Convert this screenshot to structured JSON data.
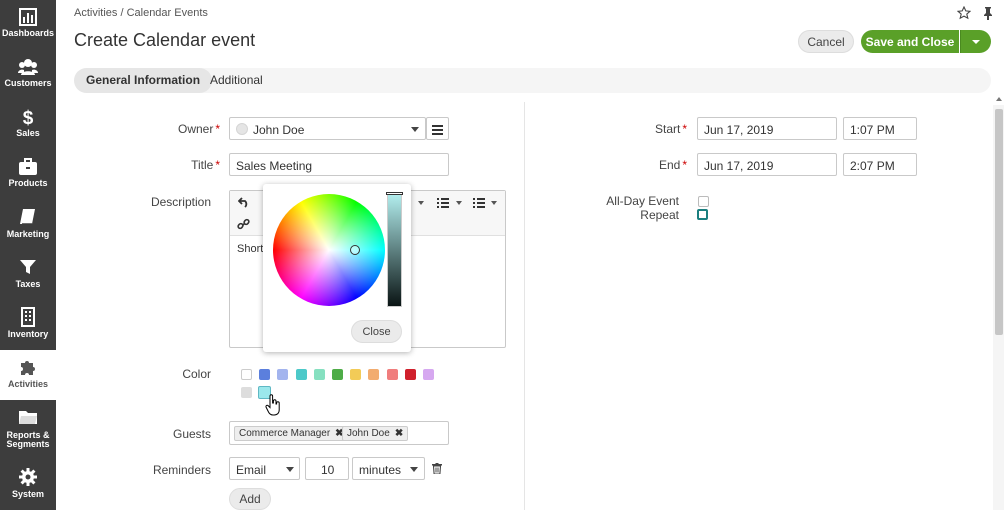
{
  "sidebar": {
    "items": [
      {
        "label": "Dashboards",
        "icon": "dashboard-icon"
      },
      {
        "label": "Customers",
        "icon": "users-icon"
      },
      {
        "label": "Sales",
        "icon": "dollar-icon"
      },
      {
        "label": "Products",
        "icon": "briefcase-icon"
      },
      {
        "label": "Marketing",
        "icon": "book-icon"
      },
      {
        "label": "Taxes",
        "icon": "filter-icon"
      },
      {
        "label": "Inventory",
        "icon": "building-icon"
      },
      {
        "label": "Activities",
        "icon": "puzzle-icon"
      },
      {
        "label": "Reports &",
        "label2": "Segments",
        "icon": "folder-icon"
      },
      {
        "label": "System",
        "icon": "gear-icon"
      }
    ],
    "active": "Activities"
  },
  "header": {
    "breadcrumb": "Activities / Calendar Events",
    "title": "Create Calendar event",
    "cancel_label": "Cancel",
    "save_label": "Save and Close"
  },
  "tabs": [
    {
      "label": "General Information",
      "active": true
    },
    {
      "label": "Additional",
      "active": false
    }
  ],
  "form": {
    "owner": {
      "label": "Owner",
      "required": "*",
      "value": "John Doe"
    },
    "title": {
      "label": "Title",
      "required": "*",
      "value": "Sales Meeting"
    },
    "description": {
      "label": "Description",
      "body": "Short s"
    },
    "color": {
      "label": "Color",
      "swatches": [
        "#ffffff",
        "#5b7fdd",
        "#a3b4ee",
        "#4cc9c9",
        "#86e0c0",
        "#4eac47",
        "#f2cb57",
        "#f2ac6f",
        "#f07d7d",
        "#d0202c",
        "#d6a8f0",
        "#dddddd",
        "#9be8ec"
      ],
      "selected": "#9be8ec"
    },
    "guests": {
      "label": "Guests",
      "tags": [
        "Commerce Manager",
        "John Doe"
      ]
    },
    "reminders": {
      "label": "Reminders",
      "type": "Email",
      "amount": "10",
      "unit": "minutes"
    },
    "add_label": "Add",
    "start": {
      "label": "Start",
      "required": "*",
      "date": "Jun 17, 2019",
      "time": "1:07 PM"
    },
    "end": {
      "label": "End",
      "required": "*",
      "date": "Jun 17, 2019",
      "time": "2:07 PM"
    },
    "all_day": {
      "label": "All-Day Event"
    },
    "repeat": {
      "label": "Repeat"
    }
  },
  "color_picker": {
    "close_label": "Close"
  },
  "colors": {
    "sidebar_bg": "#3d3d3d",
    "accent_green": "#5aa028",
    "required_red": "#cc0000"
  }
}
